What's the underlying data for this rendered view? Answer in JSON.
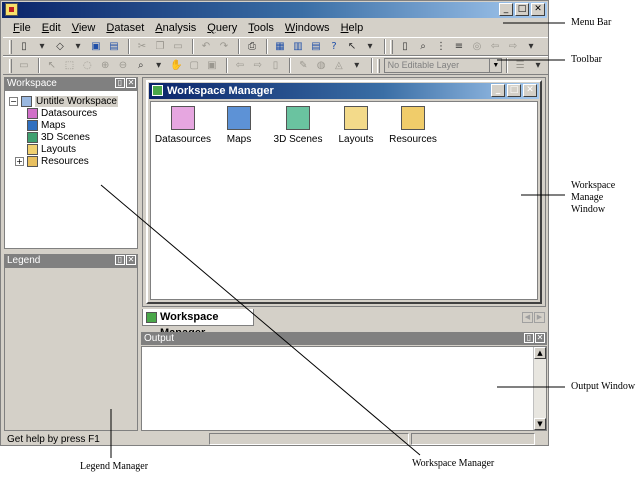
{
  "menubar": {
    "items": [
      "File",
      "Edit",
      "View",
      "Dataset",
      "Analysis",
      "Query",
      "Tools",
      "Windows",
      "Help"
    ]
  },
  "toolbar": {
    "layer_combo_value": "No Editable Layer"
  },
  "workspace_panel": {
    "title": "Workspace",
    "tree": [
      "Untitle Workspace",
      "Datasources",
      "Maps",
      "3D Scenes",
      "Layouts",
      "Resources"
    ]
  },
  "legend_panel": {
    "title": "Legend"
  },
  "workspace_manager": {
    "title": "Workspace Manager",
    "items": [
      "Datasources",
      "Maps",
      "3D Scenes",
      "Layouts",
      "Resources"
    ],
    "tab_label": "Workspace Manager"
  },
  "output_panel": {
    "title": "Output"
  },
  "status": {
    "text": "Get help by press F1"
  },
  "annotations": {
    "menu_bar": "Menu Bar",
    "toolbar": "Toolbar",
    "workspace_manage_window": [
      "Workspace",
      "Manage",
      "Window"
    ],
    "output_window": "Output Window",
    "legend_manager": "Legend Manager",
    "workspace_manager": "Workspace Manager"
  },
  "icons": {
    "app": "app-icon",
    "minimize": "minimize-icon",
    "maximize": "maximize-icon",
    "close": "close-icon"
  }
}
